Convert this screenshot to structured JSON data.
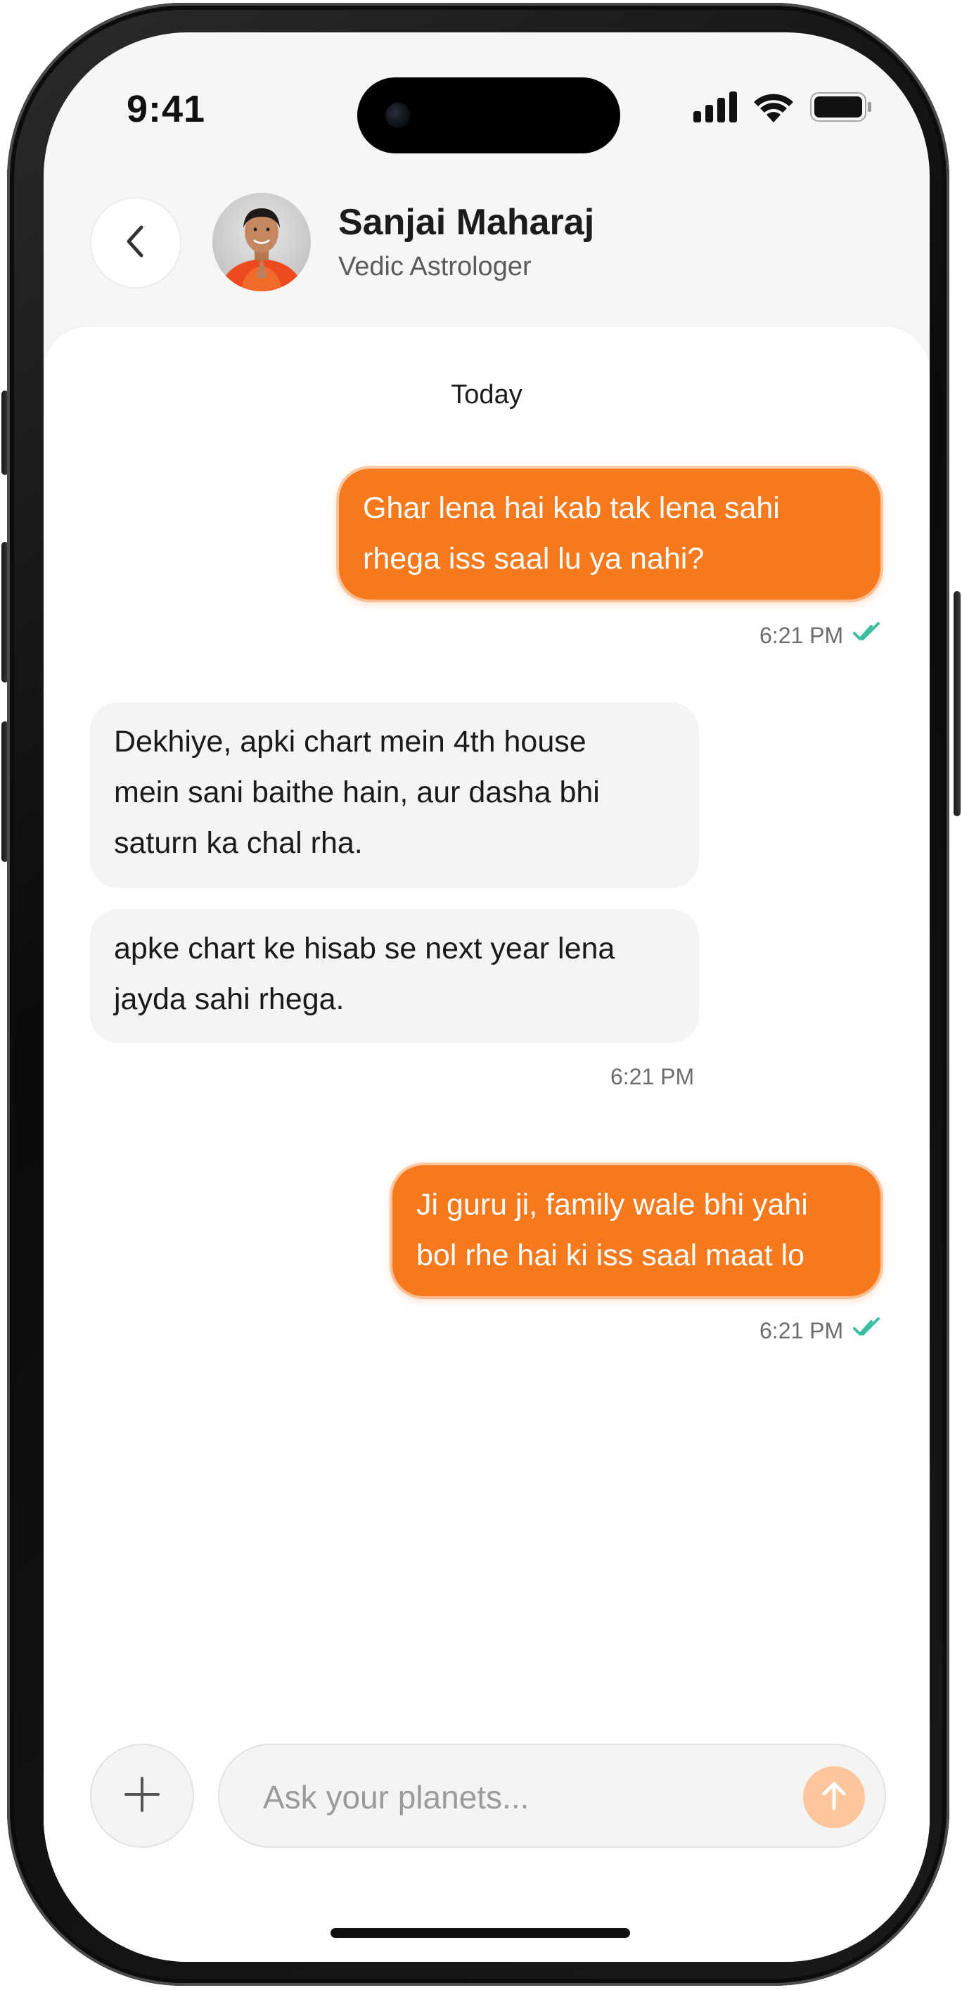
{
  "status_bar": {
    "time": "9:41",
    "icons": [
      "signal-icon",
      "wifi-icon",
      "battery-icon"
    ]
  },
  "header": {
    "back_icon": "chevron-left-icon",
    "contact_name": "Sanjai Maharaj",
    "contact_role": "Vedic Astrologer"
  },
  "chat": {
    "day_label": "Today",
    "messages": [
      {
        "direction": "outgoing",
        "lines": [
          "Ghar lena hai kab tak lena sahi",
          "rhega iss saal lu ya nahi?"
        ],
        "time": "6:21 PM",
        "status_icon": "double-check-icon"
      },
      {
        "direction": "incoming",
        "lines": [
          "Dekhiye, apki chart mein 4th house",
          "mein sani baithe hain, aur dasha bhi",
          "saturn ka chal rha."
        ]
      },
      {
        "direction": "incoming",
        "lines": [
          "apke chart ke hisab se next year lena",
          "jayda sahi rhega."
        ],
        "time": "6:21 PM"
      },
      {
        "direction": "outgoing",
        "lines": [
          "Ji guru ji, family wale bhi yahi",
          "bol rhe hai ki iss saal maat lo"
        ],
        "time": "6:21 PM",
        "status_icon": "double-check-icon"
      }
    ]
  },
  "composer": {
    "add_icon": "plus-icon",
    "placeholder": "Ask your planets...",
    "value": "",
    "send_icon": "arrow-up-icon"
  },
  "colors": {
    "accent": "#f7791d",
    "accent_soft": "#fdc69c",
    "read_tick": "#3bbfa0",
    "incoming_bubble": "#f4f4f3",
    "screen_background": "#f6f6f5"
  }
}
